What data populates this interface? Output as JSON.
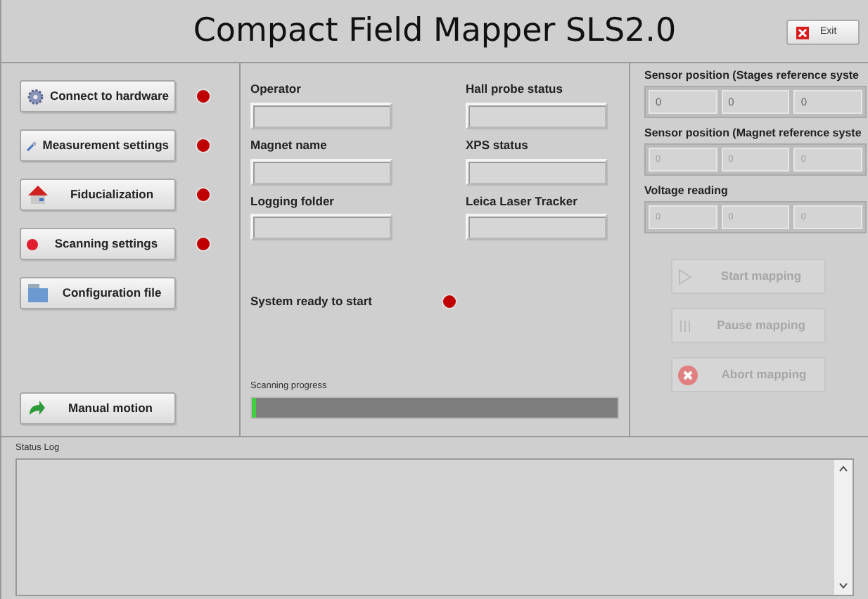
{
  "window": {
    "title": "Compact Field Mapper SLS2.0",
    "exit_button": "Exit"
  },
  "nav_buttons": [
    {
      "label": "Connect to hardware",
      "kind": "gear",
      "color": "#c00000"
    },
    {
      "label": "Measurement settings",
      "kind": "wrench",
      "color": "#c00000"
    },
    {
      "label": "Fiducialization",
      "kind": "house",
      "color": "#c00000"
    },
    {
      "label": "Scanning settings",
      "kind": "dot",
      "color": "#c00000"
    },
    {
      "label": "Configuration file",
      "kind": "folder"
    }
  ],
  "manual_button": {
    "label": "Manual motion",
    "kind": "arrow"
  },
  "fields_left": [
    {
      "label": "Operator"
    },
    {
      "label": "Magnet name"
    },
    {
      "label": "Logging folder"
    }
  ],
  "fields_right": [
    {
      "label": "Hall probe status"
    },
    {
      "label": "XPS status"
    },
    {
      "label": "Leica Laser Tracker"
    }
  ],
  "system_ready": {
    "label": "System ready to start",
    "color": "#c00000"
  },
  "progress": {
    "label": "Scanning progress",
    "level": 0.01
  },
  "readouts": [
    {
      "label": "Sensor position (Stages reference syste",
      "disabled": false,
      "values": [
        "0",
        "0",
        "0"
      ]
    },
    {
      "label": "Sensor position (Magnet reference syste",
      "disabled": true,
      "values": [
        "0",
        "0",
        "0"
      ]
    },
    {
      "label": "Voltage reading",
      "disabled": true,
      "values": [
        "0",
        "0",
        "0"
      ]
    }
  ],
  "mapping_buttons": [
    {
      "label": "Start mapping",
      "kind": "play",
      "disabled": true
    },
    {
      "label": "Pause mapping",
      "kind": "pause",
      "disabled": true
    },
    {
      "label": "Abort mapping",
      "kind": "abort",
      "disabled": true
    }
  ],
  "status_log": {
    "label": "Status Log"
  }
}
